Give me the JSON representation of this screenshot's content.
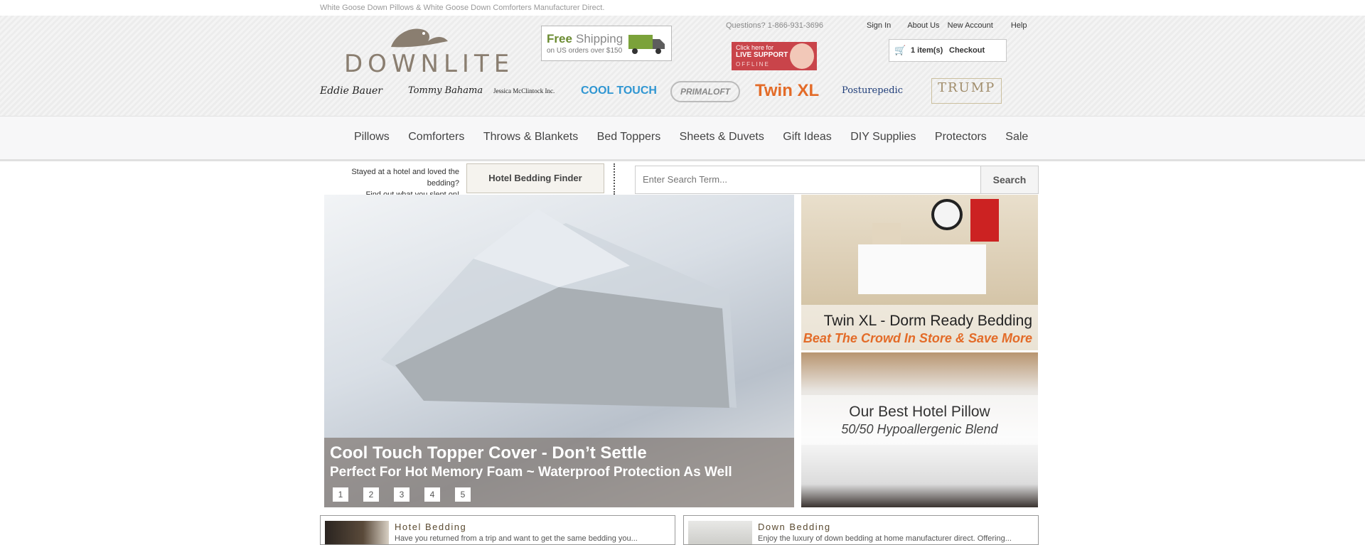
{
  "header": {
    "tagline": "White Goose Down Pillows & White Goose Down Comforters Manufacturer Direct.",
    "logo_text": "DOWNLITE",
    "shipping": {
      "free": "Free",
      "shipping": "Shipping",
      "sub": "on US orders over $150"
    },
    "phone": "Questions? 1-866-931-3696",
    "live_support": {
      "line1": "Click here for",
      "line2": "LIVE SUPPORT",
      "line3": "OFFLINE"
    },
    "links": [
      "Sign In",
      "About Us",
      "New Account",
      "Help"
    ],
    "cart": {
      "items": "1 item(s)",
      "checkout": "Checkout"
    },
    "brands": [
      "Eddie Bauer",
      "Tommy Bahama",
      "Jessica McClintock Inc.",
      "COOL TOUCH",
      "PRIMALOFT",
      "Twin XL",
      "Posturepedic",
      "TRUMP"
    ]
  },
  "nav": {
    "items": [
      "Pillows",
      "Comforters",
      "Throws & Blankets",
      "Bed Toppers",
      "Sheets & Duvets",
      "Gift Ideas",
      "DIY Supplies",
      "Protectors",
      "Sale"
    ]
  },
  "finder": {
    "question_line1": "Stayed at a hotel and loved the bedding?",
    "question_line2": "Find out what you slept on!",
    "button": "Hotel Bedding Finder"
  },
  "search": {
    "placeholder": "Enter Search Term...",
    "button": "Search"
  },
  "hero": {
    "title": "Cool Touch Topper Cover - Don’t Settle",
    "subtitle": "Perfect For Hot Memory Foam ~ Waterproof Protection As Well",
    "pages": [
      "1",
      "2",
      "3",
      "4",
      "5"
    ]
  },
  "promo1": {
    "title": "Twin XL - Dorm Ready Bedding",
    "subtitle": "Beat The Crowd In Store & Save More"
  },
  "promo2": {
    "title": "Our Best Hotel Pillow",
    "subtitle": "50/50 Hypoallergenic Blend"
  },
  "categories": [
    {
      "title": "Hotel Bedding",
      "text": "Have you returned from a trip and want to get the same bedding you..."
    },
    {
      "title": "Down Bedding",
      "text": "Enjoy the luxury of down bedding at home manufacturer direct. Offering..."
    }
  ],
  "colors": {
    "accent_orange": "#e36b28",
    "brand_brown": "#8a7e70",
    "shipping_green": "#6a8a30",
    "live_red": "#c9444a"
  }
}
